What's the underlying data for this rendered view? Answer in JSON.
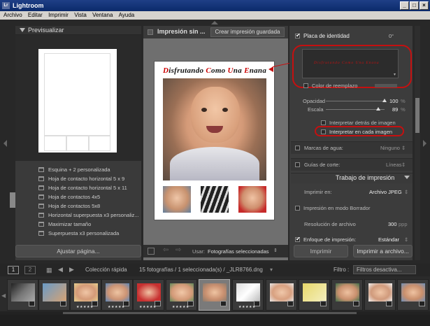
{
  "window": {
    "title": "Lightroom",
    "logo": "Lr"
  },
  "menu": [
    "Archivo",
    "Editar",
    "Imprimir",
    "Vista",
    "Ventana",
    "Ayuda"
  ],
  "left_panel": {
    "preview_title": "Previsualizar",
    "templates": [
      "Esquina + 2 personalizada",
      "Hoja de contacto horizontal 5 x 9",
      "Hoja de contacto horizontal 5 x 11",
      "Hoja de contactos 4x5",
      "Hoja de contactos 5x8",
      "Horizontal superpuesta x3 personaliz...",
      "Maximizar tamaño",
      "Superpuesta x3 personalizada"
    ],
    "fit_button": "Ajustar página..."
  },
  "center": {
    "tab_title": "Impresión sin ...",
    "save_button": "Crear impresión guardada",
    "page_title_parts": [
      {
        "t": "D",
        "red": true
      },
      {
        "t": "isfrutando ",
        "red": false
      },
      {
        "t": "C",
        "red": true
      },
      {
        "t": "omo ",
        "red": false
      },
      {
        "t": "U",
        "red": true
      },
      {
        "t": "na ",
        "red": false
      },
      {
        "t": "E",
        "red": true
      },
      {
        "t": "nana",
        "red": false
      }
    ],
    "use_label": "Usar:",
    "use_value": "Fotografías seleccionadas"
  },
  "right_panel": {
    "identity_plate": {
      "label": "Placa de identidad",
      "angle": "0°",
      "preview_text": "Disfrutando Como Una Enana"
    },
    "replace_color": "Color de reemplazo",
    "opacity": {
      "label": "Opacidad",
      "value": "100",
      "unit": "%",
      "level": 1.0
    },
    "scale": {
      "label": "Escala",
      "value": "89",
      "unit": "%",
      "level": 0.89
    },
    "behind_image": "Interpretar detrás de imagen",
    "each_image": "Interpretar en cada imagen",
    "watermark": {
      "label": "Marcas de agua:",
      "value": "Ninguno"
    },
    "cut_guides": {
      "label": "Guías de corte:",
      "value": "Líneas"
    },
    "print_job": "Trabajo de impresión",
    "print_to": {
      "label": "Imprimir en:",
      "value": "Archivo JPEG"
    },
    "draft_mode": "Impresión en modo Borrador",
    "file_resolution": {
      "label": "Resolución de archivo",
      "value": "300",
      "unit": "ppp"
    },
    "sharpening": {
      "label": "Enfoque de impresión:",
      "value": "Estándar"
    },
    "print_button": "Imprimir",
    "print_file_button": "Imprimir a archivo..."
  },
  "filmstrip": {
    "monitors": [
      "1",
      "2"
    ],
    "source": "Colección rápida",
    "count": "15 fotografías",
    "selected": "/ 1 seleccionada(s) / _JLR8766.dng",
    "filter_label": "Filtro :",
    "filter_value": "Filtros desactiva...",
    "stars": "★★★★★"
  },
  "colors": {
    "accent_red": "#c51010",
    "panel_bg": "#3c3c3c",
    "titlebar": "#0b2a6b"
  }
}
